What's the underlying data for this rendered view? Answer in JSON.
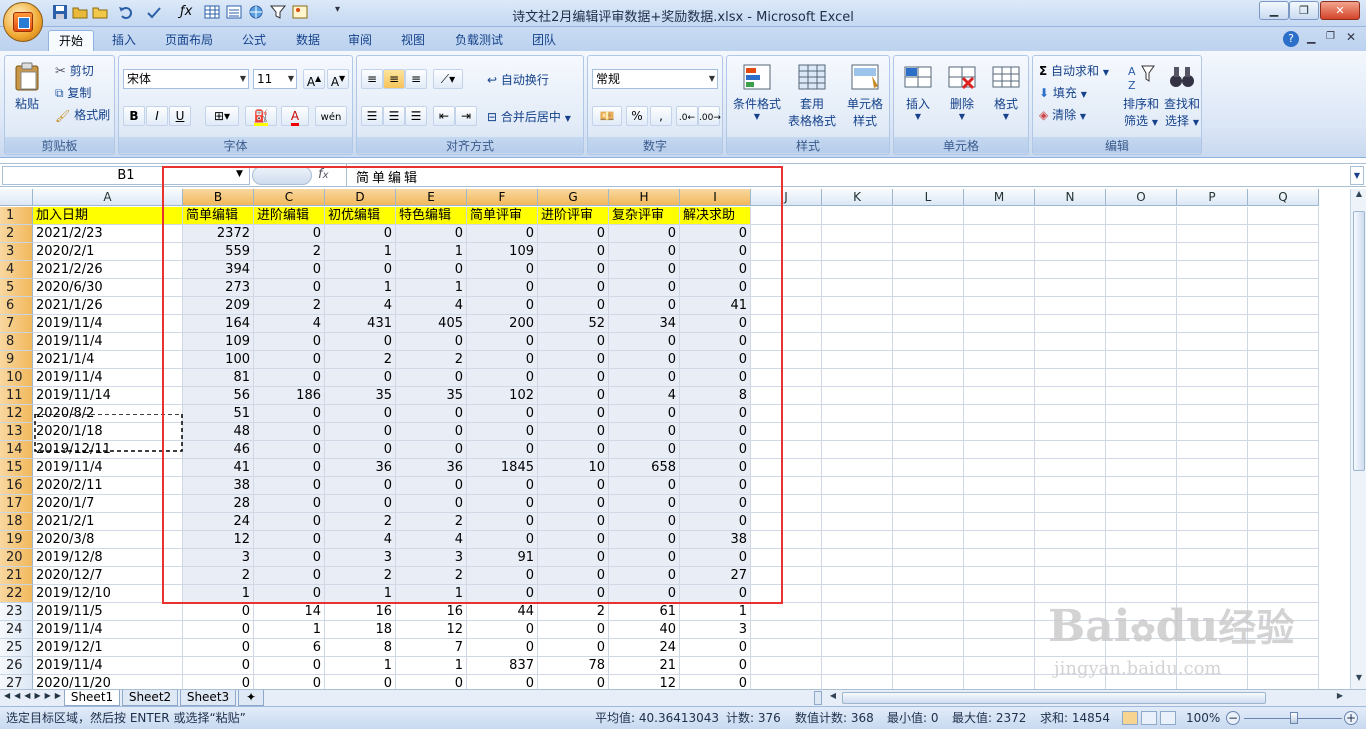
{
  "window": {
    "title": "诗文社2月编辑评审数据+奖励数据.xlsx - Microsoft Excel"
  },
  "ribbon_tabs": [
    "开始",
    "插入",
    "页面布局",
    "公式",
    "数据",
    "审阅",
    "视图",
    "负载测试",
    "团队"
  ],
  "clipboard": {
    "paste": "粘贴",
    "cut": "剪切",
    "copy": "复制",
    "format_painter": "格式刷",
    "label": "剪贴板"
  },
  "font": {
    "name": "宋体",
    "size": "11",
    "bold": "B",
    "italic": "I",
    "underline": "U",
    "label": "字体"
  },
  "alignment": {
    "wrap_text": "自动换行",
    "merge_center": "合并后居中",
    "label": "对齐方式"
  },
  "number": {
    "format": "常规",
    "percent": "%",
    "comma": ",",
    "label": "数字"
  },
  "styles": {
    "conditional": "条件格式",
    "table_format": "套用\n表格格式",
    "table_format_line1": "套用",
    "table_format_line2": "表格格式",
    "cell_styles_line1": "单元格",
    "cell_styles_line2": "样式",
    "label": "样式"
  },
  "cells": {
    "insert": "插入",
    "delete": "删除",
    "format": "格式",
    "label": "单元格"
  },
  "editing": {
    "autosum": "自动求和",
    "fill": "填充",
    "clear": "清除",
    "sort_line1": "排序和",
    "sort_line2": "筛选",
    "find_line1": "查找和",
    "find_line2": "选择",
    "label": "编辑"
  },
  "formula_bar": {
    "name_box": "B1",
    "fx": "fx",
    "content": "简单编辑"
  },
  "columns": [
    "A",
    "B",
    "C",
    "D",
    "E",
    "F",
    "G",
    "H",
    "I",
    "J",
    "K",
    "L",
    "M",
    "N",
    "O",
    "P",
    "Q"
  ],
  "header_row": [
    "加入日期",
    "简单编辑",
    "进阶编辑",
    "初优编辑",
    "特色编辑",
    "简单评审",
    "进阶评审",
    "复杂评审",
    "解决求助"
  ],
  "rows": [
    [
      "2021/2/23",
      "2372",
      "0",
      "0",
      "0",
      "0",
      "0",
      "0",
      "0"
    ],
    [
      "2020/2/1",
      "559",
      "2",
      "1",
      "1",
      "109",
      "0",
      "0",
      "0"
    ],
    [
      "2021/2/26",
      "394",
      "0",
      "0",
      "0",
      "0",
      "0",
      "0",
      "0"
    ],
    [
      "2020/6/30",
      "273",
      "0",
      "1",
      "1",
      "0",
      "0",
      "0",
      "0"
    ],
    [
      "2021/1/26",
      "209",
      "2",
      "4",
      "4",
      "0",
      "0",
      "0",
      "41"
    ],
    [
      "2019/11/4",
      "164",
      "4",
      "431",
      "405",
      "200",
      "52",
      "34",
      "0"
    ],
    [
      "2019/11/4",
      "109",
      "0",
      "0",
      "0",
      "0",
      "0",
      "0",
      "0"
    ],
    [
      "2021/1/4",
      "100",
      "0",
      "2",
      "2",
      "0",
      "0",
      "0",
      "0"
    ],
    [
      "2019/11/4",
      "81",
      "0",
      "0",
      "0",
      "0",
      "0",
      "0",
      "0"
    ],
    [
      "2019/11/14",
      "56",
      "186",
      "35",
      "35",
      "102",
      "0",
      "4",
      "8"
    ],
    [
      "2020/8/2",
      "51",
      "0",
      "0",
      "0",
      "0",
      "0",
      "0",
      "0"
    ],
    [
      "2020/1/18",
      "48",
      "0",
      "0",
      "0",
      "0",
      "0",
      "0",
      "0"
    ],
    [
      "2019/12/11",
      "46",
      "0",
      "0",
      "0",
      "0",
      "0",
      "0",
      "0"
    ],
    [
      "2019/11/4",
      "41",
      "0",
      "36",
      "36",
      "1845",
      "10",
      "658",
      "0"
    ],
    [
      "2020/2/11",
      "38",
      "0",
      "0",
      "0",
      "0",
      "0",
      "0",
      "0"
    ],
    [
      "2020/1/7",
      "28",
      "0",
      "0",
      "0",
      "0",
      "0",
      "0",
      "0"
    ],
    [
      "2021/2/1",
      "24",
      "0",
      "2",
      "2",
      "0",
      "0",
      "0",
      "0"
    ],
    [
      "2020/3/8",
      "12",
      "0",
      "4",
      "4",
      "0",
      "0",
      "0",
      "38"
    ],
    [
      "2019/12/8",
      "3",
      "0",
      "3",
      "3",
      "91",
      "0",
      "0",
      "0"
    ],
    [
      "2020/12/7",
      "2",
      "0",
      "2",
      "2",
      "0",
      "0",
      "0",
      "27"
    ],
    [
      "2019/12/10",
      "1",
      "0",
      "1",
      "1",
      "0",
      "0",
      "0",
      "0"
    ],
    [
      "2019/11/5",
      "0",
      "14",
      "16",
      "16",
      "44",
      "2",
      "61",
      "1"
    ],
    [
      "2019/11/4",
      "0",
      "1",
      "18",
      "12",
      "0",
      "0",
      "40",
      "3"
    ],
    [
      "2019/12/1",
      "0",
      "6",
      "8",
      "7",
      "0",
      "0",
      "24",
      "0"
    ],
    [
      "2019/11/4",
      "0",
      "0",
      "1",
      "1",
      "837",
      "78",
      "21",
      "0"
    ],
    [
      "2020/11/20",
      "0",
      "0",
      "0",
      "0",
      "0",
      "0",
      "12",
      "0"
    ]
  ],
  "sheet_tabs": [
    "Sheet1",
    "Sheet2",
    "Sheet3"
  ],
  "status": {
    "message": "选定目标区域，然后按 ENTER 或选择“粘贴”",
    "average": "平均值: 40.36413043",
    "count": "计数: 376",
    "numeric_count": "数值计数: 368",
    "min": "最小值: 0",
    "max": "最大值: 2372",
    "sum": "求和: 14854",
    "zoom": "100%"
  },
  "watermark": {
    "brand": "Bai",
    "brand2": "du",
    "brand_cn": "经验",
    "url": "jingyan.baidu.com"
  },
  "colors": {
    "accent": "#e8322f",
    "header_fill": "#ffff00",
    "selection": "#e9edf6"
  }
}
